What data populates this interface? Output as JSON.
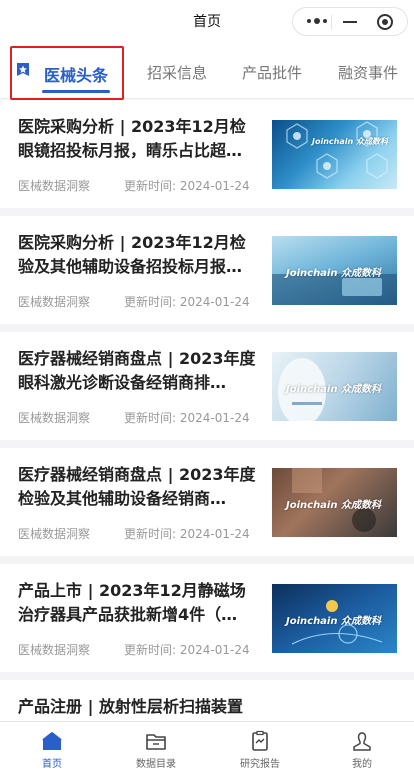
{
  "header": {
    "title": "首页"
  },
  "tabs": [
    {
      "label": "医械头条",
      "active": true
    },
    {
      "label": "招采信息"
    },
    {
      "label": "产品批件"
    },
    {
      "label": "融资事件"
    }
  ],
  "accent_color": "#2a5ec9",
  "highlight_border_color": "#e02020",
  "articles": [
    {
      "title": "医院采购分析 | 2023年12月检眼镜招投标月报，睛乐占比超…",
      "source": "医械数据洞察",
      "time": "更新时间: 2024-01-24",
      "brand": "Joinchain 众成数科"
    },
    {
      "title": "医院采购分析 | 2023年12月检验及其他辅助设备招投标月报…",
      "source": "医械数据洞察",
      "time": "更新时间: 2024-01-24",
      "brand": "Joinchain 众成数科"
    },
    {
      "title": "医疗器械经销商盘点 | 2023年度眼科激光诊断设备经销商排…",
      "source": "医械数据洞察",
      "time": "更新时间: 2024-01-24",
      "brand": "Joinchain 众成数科"
    },
    {
      "title": "医疗器械经销商盘点 | 2023年度检验及其他辅助设备经销商…",
      "source": "医械数据洞察",
      "time": "更新时间: 2024-01-24",
      "brand": "Joinchain 众成数科"
    },
    {
      "title": "产品上市 | 2023年12月静磁场治疗器具产品获批新增4件（…",
      "source": "医械数据洞察",
      "time": "更新时间: 2024-01-24",
      "brand": "Joinchain 众成数科"
    },
    {
      "title": "产品注册 | 放射性层析扫描装置",
      "source": "",
      "time": "",
      "brand": ""
    }
  ],
  "bottom_nav": [
    {
      "label": "首页",
      "icon": "home-icon",
      "active": true
    },
    {
      "label": "数据目录",
      "icon": "folder-icon"
    },
    {
      "label": "研究报告",
      "icon": "report-icon"
    },
    {
      "label": "我的",
      "icon": "user-icon"
    }
  ]
}
